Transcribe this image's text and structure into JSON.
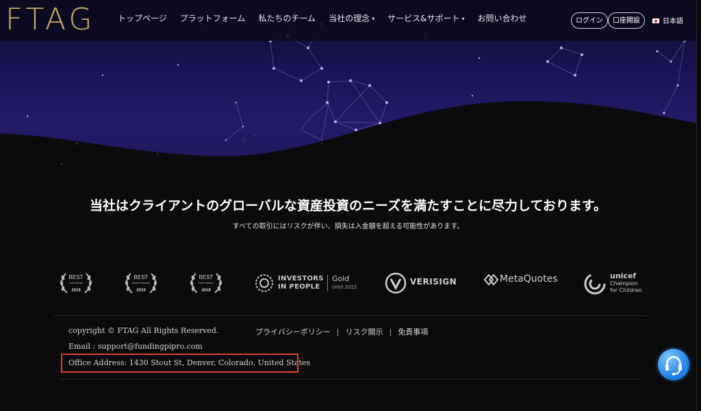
{
  "header": {
    "logo": "FTAG",
    "nav": [
      {
        "label": "トップページ",
        "has_caret": false
      },
      {
        "label": "プラットフォーム",
        "has_caret": false
      },
      {
        "label": "私たちのチーム",
        "has_caret": false
      },
      {
        "label": "当社の理念",
        "has_caret": true
      },
      {
        "label": "サービス&サポート",
        "has_caret": true
      },
      {
        "label": "お問い合わせ",
        "has_caret": false
      }
    ],
    "login_label": "ログイン",
    "open_account_label": "口座開設",
    "language_label": "日本語",
    "caret_glyph": "▾"
  },
  "hero": {
    "tagline": "当社はクライアントのグローバルな資産投資のニーズを満たすことに尽力しております。",
    "subline": "すべての取引にはリスクが伴い、損失は入金額を超える可能性があります。"
  },
  "awards": [
    {
      "title": "BEST",
      "subtitle": "Forex Broker",
      "year": "2019"
    },
    {
      "title": "BEST",
      "subtitle": "Market Research",
      "year": "2019"
    },
    {
      "title": "BEST",
      "subtitle": "Forex Platform",
      "year": "2019"
    }
  ],
  "partners": {
    "investors_line1": "INVESTORS",
    "investors_line2": "IN PEOPLE",
    "investors_level": "Gold",
    "investors_until": "Until 2022",
    "verisign": "VERISIGN",
    "metaquotes": "MetaQuotes",
    "unicef_name": "unicef",
    "unicef_line2": "Champion",
    "unicef_line3": "for Children"
  },
  "footer": {
    "copyright": "copyright © FTAG All Rights Reserved.",
    "email": "Email : support@fundingpipro.com",
    "address": "Office Address: 1430 Stout St, Denver, Colorado, United States",
    "links": [
      "プライバシーポリシー",
      "リスク開示",
      "免責事項"
    ]
  },
  "colors": {
    "logo_gold": "#c9b06a",
    "highlight_box": "#e2402a",
    "support_blue": "#1a7be0"
  }
}
